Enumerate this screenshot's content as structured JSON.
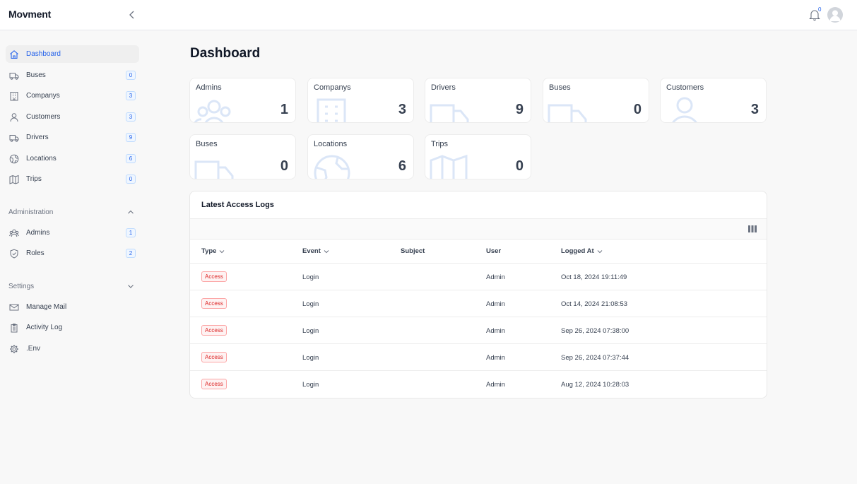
{
  "app": {
    "brand": "Movment"
  },
  "header": {
    "notification_count": "0"
  },
  "sidebar": {
    "items": [
      {
        "label": "Dashboard",
        "icon": "home-icon"
      },
      {
        "label": "Buses",
        "badge": "0",
        "icon": "truck-icon"
      },
      {
        "label": "Companys",
        "badge": "3",
        "icon": "building-icon"
      },
      {
        "label": "Customers",
        "badge": "3",
        "icon": "user-icon"
      },
      {
        "label": "Drivers",
        "badge": "9",
        "icon": "truck-icon"
      },
      {
        "label": "Locations",
        "badge": "6",
        "icon": "globe-icon"
      },
      {
        "label": "Trips",
        "badge": "0",
        "icon": "map-icon"
      }
    ],
    "administration": {
      "label": "Administration",
      "items": [
        {
          "label": "Admins",
          "badge": "1",
          "icon": "users-icon"
        },
        {
          "label": "Roles",
          "badge": "2",
          "icon": "shield-icon"
        }
      ]
    },
    "settings": {
      "label": "Settings",
      "items": [
        {
          "label": "Manage Mail",
          "icon": "envelope-icon"
        },
        {
          "label": "Activity Log",
          "icon": "clipboard-icon"
        },
        {
          "label": ".Env",
          "icon": "gear-icon"
        }
      ]
    }
  },
  "main": {
    "title": "Dashboard",
    "stats": [
      {
        "label": "Admins",
        "value": "1",
        "icon": "users-icon"
      },
      {
        "label": "Companys",
        "value": "3",
        "icon": "building-icon"
      },
      {
        "label": "Drivers",
        "value": "9",
        "icon": "truck-icon"
      },
      {
        "label": "Buses",
        "value": "0",
        "icon": "truck-icon"
      },
      {
        "label": "Customers",
        "value": "3",
        "icon": "user-icon"
      },
      {
        "label": "Buses",
        "value": "0",
        "icon": "truck-icon"
      },
      {
        "label": "Locations",
        "value": "6",
        "icon": "globe-icon"
      },
      {
        "label": "Trips",
        "value": "0",
        "icon": "map-icon"
      }
    ],
    "logs": {
      "title": "Latest Access Logs",
      "columns": {
        "type": "Type",
        "event": "Event",
        "subject": "Subject",
        "user": "User",
        "logged_at": "Logged At"
      },
      "rows": [
        {
          "type": "Access",
          "event": "Login",
          "subject": "",
          "user": "Admin",
          "logged_at": "Oct 18, 2024 19:11:49"
        },
        {
          "type": "Access",
          "event": "Login",
          "subject": "",
          "user": "Admin",
          "logged_at": "Oct 14, 2024 21:08:53"
        },
        {
          "type": "Access",
          "event": "Login",
          "subject": "",
          "user": "Admin",
          "logged_at": "Sep 26, 2024 07:38:00"
        },
        {
          "type": "Access",
          "event": "Login",
          "subject": "",
          "user": "Admin",
          "logged_at": "Sep 26, 2024 07:37:44"
        },
        {
          "type": "Access",
          "event": "Login",
          "subject": "",
          "user": "Admin",
          "logged_at": "Aug 12, 2024 10:28:03"
        }
      ]
    }
  },
  "colors": {
    "accent": "#2563eb",
    "badge_red": "#dc2626",
    "icon_faint": "#dbe6f7"
  }
}
